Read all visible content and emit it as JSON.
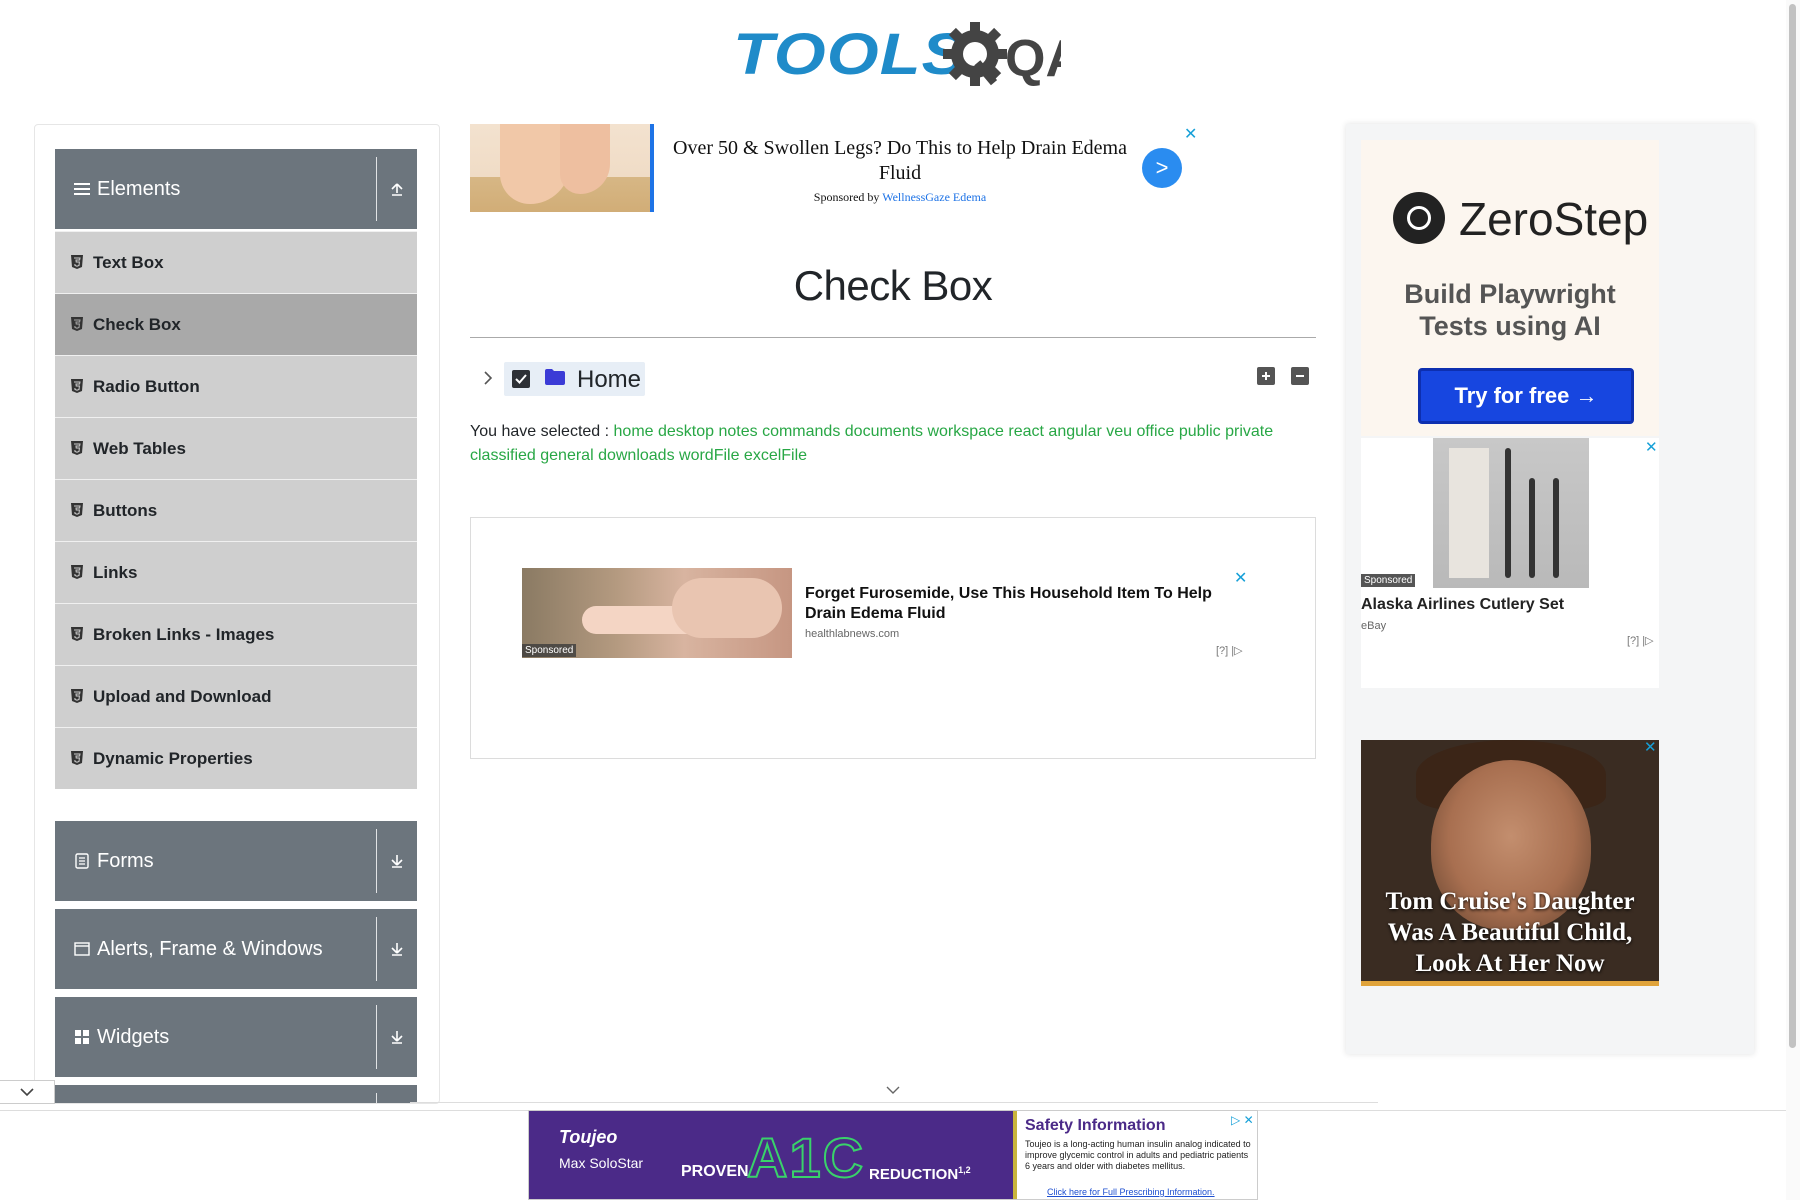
{
  "logo": {
    "text": "TOOLS",
    "suffix": "QA"
  },
  "sidebar": {
    "elements_header": "Elements",
    "items": [
      {
        "label": "Text Box"
      },
      {
        "label": "Check Box"
      },
      {
        "label": "Radio Button"
      },
      {
        "label": "Web Tables"
      },
      {
        "label": "Buttons"
      },
      {
        "label": "Links"
      },
      {
        "label": "Broken Links - Images"
      },
      {
        "label": "Upload and Download"
      },
      {
        "label": "Dynamic Properties"
      }
    ],
    "groups": [
      {
        "label": "Forms"
      },
      {
        "label": "Alerts, Frame & Windows"
      },
      {
        "label": "Widgets"
      }
    ]
  },
  "top_ad": {
    "headline": "Over 50 & Swollen Legs? Do This to Help Drain Edema Fluid",
    "sponsored_prefix": "Sponsored by",
    "sponsor": "WellnessGaze Edema",
    "button": ">",
    "close": "✕"
  },
  "main": {
    "title": "Check Box",
    "tree_root_label": "Home",
    "selected_prefix": "You have selected :",
    "selected_items": "home desktop notes commands documents workspace react angular veu office public private classified general downloads wordFile excelFile"
  },
  "mid_ad": {
    "headline": "Forget Furosemide, Use This Household Item To Help Drain Edema Fluid",
    "domain": "healthlabnews.com",
    "sponsored": "Sponsored",
    "adchoice": "[?] |▷",
    "close": "✕"
  },
  "right_ads": {
    "zerostep": {
      "name": "ZeroStep",
      "tagline": "Build Playwright Tests using AI",
      "button": "Try for free →"
    },
    "cutlery": {
      "sponsored": "Sponsored",
      "title": "Alaska Airlines Cutlery Set",
      "source": "eBay",
      "adchoice": "[?] |▷",
      "close": "✕"
    },
    "celebrity": {
      "headline": "Tom Cruise's Daughter Was A Beautiful Child, Look At Her Now",
      "close": "✕"
    }
  },
  "bottom_ad": {
    "brand": "Toujeo",
    "brand_sub": "Max SoloStar",
    "proven": "PROVEN",
    "a1c": "A1C",
    "reduction": "REDUCTION",
    "reduction_sup": "1,2",
    "safety_heading": "Safety Information",
    "safety_body": "Toujeo is a long-acting human insulin analog indicated to improve glycemic control in adults and pediatric patients 6 years and older with diabetes mellitus.",
    "link": "Click here for Full Prescribing Information.",
    "close": "▷ ✕"
  }
}
